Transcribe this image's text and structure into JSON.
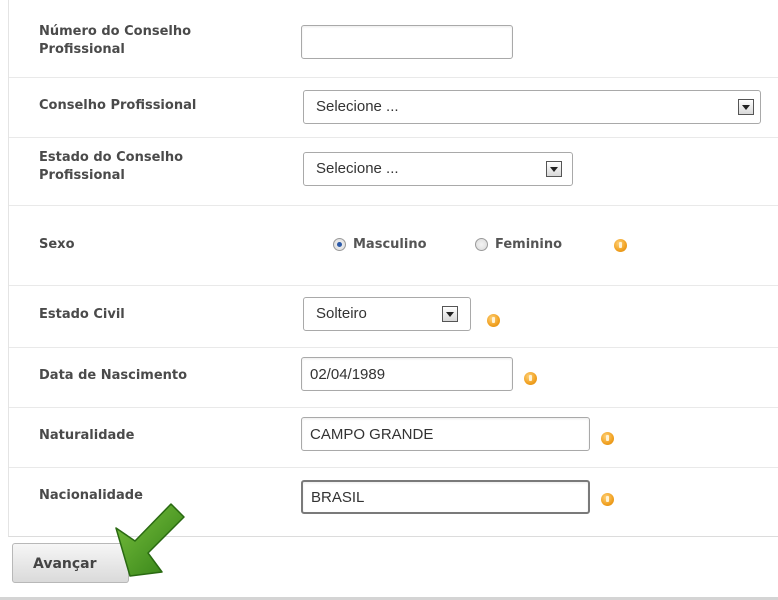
{
  "form": {
    "conselho_numero": {
      "label": "Número do Conselho Profissional",
      "value": ""
    },
    "conselho_profissional": {
      "label": "Conselho Profissional",
      "selected": "Selecione ..."
    },
    "estado_conselho": {
      "label": "Estado do Conselho Profissional",
      "selected": "Selecione ..."
    },
    "sexo": {
      "label": "Sexo",
      "options": [
        "Masculino",
        "Feminino"
      ],
      "selected": "Masculino"
    },
    "estado_civil": {
      "label": "Estado Civil",
      "selected": "Solteiro"
    },
    "data_nascimento": {
      "label": "Data de Nascimento",
      "value": "02/04/1989"
    },
    "naturalidade": {
      "label": "Naturalidade",
      "value": "CAMPO GRANDE"
    },
    "nacionalidade": {
      "label": "Nacionalidade",
      "value": "BRASIL"
    }
  },
  "actions": {
    "next_label": "Avançar"
  },
  "icons": {
    "required": "warning-icon",
    "pointer": "green-arrow-icon"
  },
  "colors": {
    "warning": "#f0a020",
    "arrow": "#3f9a1e",
    "radio_checked": "#2c5aa8"
  }
}
